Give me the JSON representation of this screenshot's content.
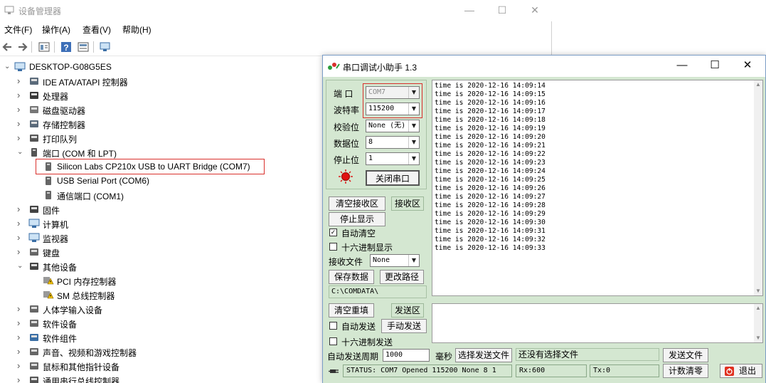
{
  "device_manager": {
    "title": "设备管理器",
    "window_controls": {
      "minimize": "—",
      "maximize": "☐",
      "close": "✕"
    },
    "menu": [
      "文件(F)",
      "操作(A)",
      "查看(V)",
      "帮助(H)"
    ],
    "tree": {
      "root": "DESKTOP-G08G5ES",
      "items": [
        {
          "label": "IDE ATA/ATAPI 控制器",
          "icon": "ide-controller-icon",
          "expanded": false
        },
        {
          "label": "处理器",
          "icon": "processor-icon",
          "expanded": false
        },
        {
          "label": "磁盘驱动器",
          "icon": "disk-drive-icon",
          "expanded": false
        },
        {
          "label": "存储控制器",
          "icon": "storage-controller-icon",
          "expanded": false
        },
        {
          "label": "打印队列",
          "icon": "printer-icon",
          "expanded": false
        },
        {
          "label": "端口 (COM 和 LPT)",
          "icon": "port-icon",
          "expanded": true
        },
        {
          "label": "Silicon Labs CP210x USB to UART Bridge (COM7)",
          "icon": "port-device-icon",
          "child": true
        },
        {
          "label": "USB Serial Port (COM6)",
          "icon": "port-device-icon",
          "child": true
        },
        {
          "label": "通信端口 (COM1)",
          "icon": "port-device-icon",
          "child": true
        },
        {
          "label": "固件",
          "icon": "firmware-icon",
          "expanded": false
        },
        {
          "label": "计算机",
          "icon": "computer-icon",
          "expanded": false
        },
        {
          "label": "监视器",
          "icon": "monitor-icon",
          "expanded": false
        },
        {
          "label": "键盘",
          "icon": "keyboard-icon",
          "expanded": false
        },
        {
          "label": "其他设备",
          "icon": "other-devices-icon",
          "expanded": true
        },
        {
          "label": "PCI 内存控制器",
          "icon": "warning-device-icon",
          "child": true
        },
        {
          "label": "SM 总线控制器",
          "icon": "warning-device-icon",
          "child": true
        },
        {
          "label": "人体学输入设备",
          "icon": "hid-icon",
          "expanded": false
        },
        {
          "label": "软件设备",
          "icon": "software-device-icon",
          "expanded": false
        },
        {
          "label": "软件组件",
          "icon": "software-component-icon",
          "expanded": false
        },
        {
          "label": "声音、视频和游戏控制器",
          "icon": "sound-icon",
          "expanded": false
        },
        {
          "label": "鼠标和其他指针设备",
          "icon": "mouse-icon",
          "expanded": false
        },
        {
          "label": "通用串行总线控制器",
          "icon": "usb-icon",
          "expanded": false
        }
      ]
    }
  },
  "serial_assistant": {
    "title": "串口调试小助手 1.3",
    "window_controls": {
      "minimize": "—",
      "maximize": "☐",
      "close": "✕"
    },
    "settings": {
      "port_label": "端  口",
      "port_value": "COM7",
      "baud_label": "波特率",
      "baud_value": "115200",
      "parity_label": "校验位",
      "parity_value": "None (无)",
      "databits_label": "数据位",
      "databits_value": "8",
      "stopbits_label": "停止位",
      "stopbits_value": "1",
      "close_port_button": "关闭串口"
    },
    "receive": {
      "clear_button": "清空接收区",
      "area_label": "接收区",
      "stop_display_button": "停止显示",
      "auto_clear_label": "自动清空",
      "auto_clear_checked": true,
      "hex_display_label": "十六进制显示",
      "hex_display_checked": false,
      "file_label": "接收文件",
      "file_value": "None",
      "save_button": "保存数据",
      "change_path_button": "更改路径",
      "path_value": "C:\\COMDATA\\",
      "lines": [
        "time is 2020-12-16 14:09:14",
        "time is 2020-12-16 14:09:15",
        "time is 2020-12-16 14:09:16",
        "time is 2020-12-16 14:09:17",
        "time is 2020-12-16 14:09:18",
        "time is 2020-12-16 14:09:19",
        "time is 2020-12-16 14:09:20",
        "time is 2020-12-16 14:09:21",
        "time is 2020-12-16 14:09:22",
        "time is 2020-12-16 14:09:23",
        "time is 2020-12-16 14:09:24",
        "time is 2020-12-16 14:09:25",
        "time is 2020-12-16 14:09:26",
        "time is 2020-12-16 14:09:27",
        "time is 2020-12-16 14:09:28",
        "time is 2020-12-16 14:09:29",
        "time is 2020-12-16 14:09:30",
        "time is 2020-12-16 14:09:31",
        "time is 2020-12-16 14:09:32",
        "time is 2020-12-16 14:09:33"
      ]
    },
    "send": {
      "clear_button": "清空重填",
      "area_label": "发送区",
      "auto_send_label": "自动发送",
      "auto_send_checked": false,
      "manual_send_button": "手动发送",
      "hex_send_label": "十六进制发送",
      "hex_send_checked": false,
      "period_label": "自动发送周期",
      "period_value": "1000",
      "period_unit": "毫秒",
      "select_file_button": "选择发送文件",
      "file_status": "还没有选择文件",
      "send_file_button": "发送文件"
    },
    "status": {
      "status_text": "STATUS: COM7 Opened 115200 None  8 1",
      "rx_text": "Rx:600",
      "tx_text": "Tx:0",
      "reset_count_button": "计数清零",
      "exit_button": "退出"
    }
  },
  "colors": {
    "panel_green": "#d4e7d1",
    "highlight_red": "#d9302c",
    "led_red": "#e01010"
  }
}
